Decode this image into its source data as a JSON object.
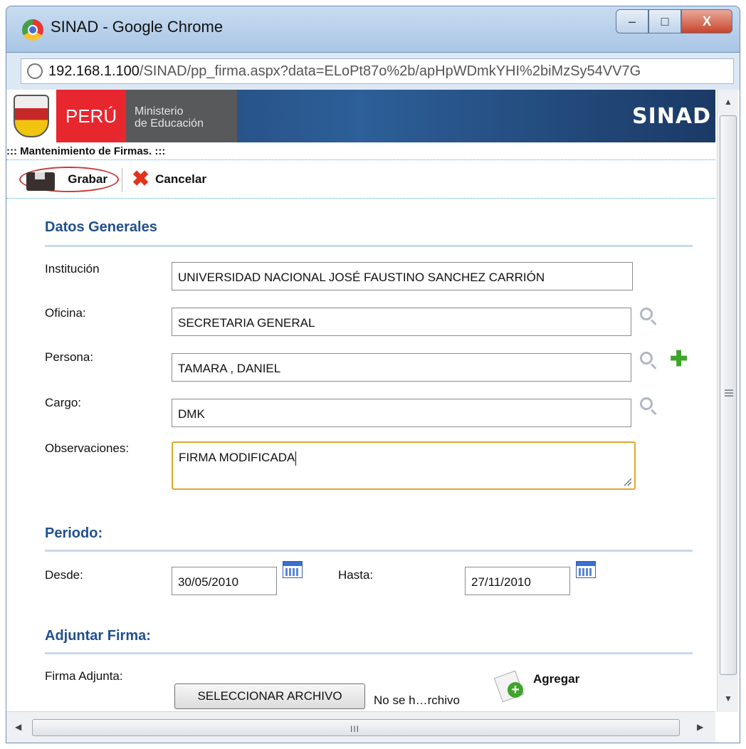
{
  "window": {
    "title": "SINAD - Google Chrome",
    "minimize": "–",
    "maximize": "□",
    "close": "X"
  },
  "address_bar": {
    "host": "192.168.1.100",
    "path": "/SINAD/pp_firma.aspx?data=ELoPt87o%2b/apHpWDmkYHI%2biMzSy54VV7G"
  },
  "banner": {
    "country": "PERÚ",
    "ministry_line1": "Ministerio",
    "ministry_line2": "de Educación",
    "app_name": "SINAD"
  },
  "breadcrumb": "::: Mantenimiento de Firmas. :::",
  "toolbar": {
    "save_label": "Grabar",
    "cancel_label": "Cancelar"
  },
  "sections": {
    "general": "Datos Generales",
    "period": "Periodo:",
    "attach": "Adjuntar Firma:"
  },
  "form": {
    "institucion_label": "Institución",
    "institucion_value": "UNIVERSIDAD NACIONAL JOSÉ FAUSTINO SANCHEZ CARRIÓN",
    "oficina_label": "Oficina:",
    "oficina_value": "SECRETARIA GENERAL",
    "persona_label": "Persona:",
    "persona_value": "TAMARA , DANIEL",
    "cargo_label": "Cargo:",
    "cargo_value": "DMK",
    "observaciones_label": "Observaciones:",
    "observaciones_value": "FIRMA MODIFICADA"
  },
  "period": {
    "desde_label": "Desde:",
    "desde_value": "30/05/2010",
    "hasta_label": "Hasta:",
    "hasta_value": "27/11/2010"
  },
  "attachment": {
    "label": "Firma Adjunta:",
    "select_button": "SELECCIONAR ARCHIVO",
    "file_status": "No se h…rchivo",
    "add_label": "Agregar"
  },
  "scrollbar": {
    "grip": "III"
  }
}
